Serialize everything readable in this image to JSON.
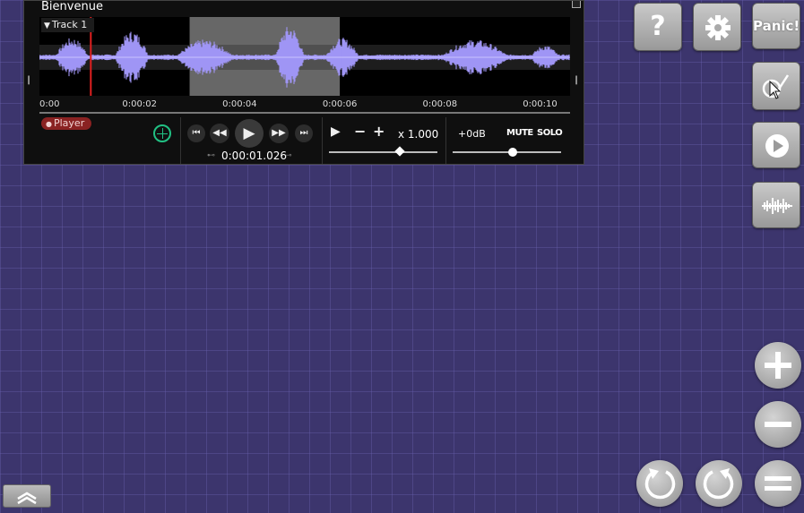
{
  "window": {
    "title": "Bienvenue"
  },
  "track": {
    "label": "Track 1",
    "timeline": [
      "0:00",
      "0:00:02",
      "0:00:04",
      "0:00:06",
      "0:00:08",
      "0:00:10"
    ],
    "playhead_time_s": 1.026,
    "selection_start_s": 3.0,
    "selection_end_s": 6.0,
    "duration_s": 10.6
  },
  "player": {
    "badge": "Player",
    "time": "0:00:01.026",
    "speed": "x 1.000",
    "gain": "+0dB",
    "mute_label": "MUTE",
    "solo_label": "SOLO",
    "speed_level": 0.65,
    "volume_level": 0.55
  },
  "buttons": {
    "panic": "Panic!",
    "help": "?"
  },
  "colors": {
    "background": "#3c356d",
    "waveform": "#9f95f5",
    "playhead": "#e02020",
    "loop": "#21c083",
    "badge": "#8a2222"
  },
  "icons": [
    "help-icon",
    "gear-icon",
    "metronome-icon",
    "play-icon",
    "waveform-icon",
    "plus-icon",
    "minus-icon",
    "equals-icon",
    "undo-icon",
    "redo-icon",
    "collapse-icon"
  ]
}
